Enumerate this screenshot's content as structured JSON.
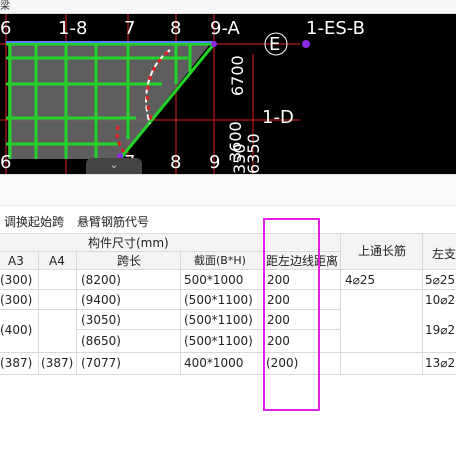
{
  "window": {
    "title_fragment": "梁"
  },
  "cad": {
    "top_labels": [
      "6",
      "1-8",
      "7",
      "8",
      "9-A",
      "E",
      "1-ES-B"
    ],
    "bottom_labels": [
      "6",
      "7",
      "8",
      "9"
    ],
    "side_labels": [
      "1-D"
    ],
    "dimension_labels": [
      "6700",
      "3600",
      "6350",
      "350"
    ],
    "grip_label": "⌄",
    "colors": {
      "background": "#000000",
      "beam_green": "#22d42a",
      "axis_red": "#e02020",
      "purple_marker": "#8a2be2"
    }
  },
  "toolbar": {
    "swap_start_span_label": "调换起始跨",
    "cantilever_rebar_code_label": "悬臂钢筋代号"
  },
  "table": {
    "group_header": "构件尺寸(mm)",
    "columns": {
      "a3": "A3",
      "a4": "A4",
      "span": "跨长",
      "section": "截面(B*H)",
      "offset": "距左边线距离",
      "top_rebar": "上通长筋",
      "left_support": "左支"
    },
    "rows": [
      {
        "a3": "(300)",
        "a4": "",
        "span": "(8200)",
        "section": "500*1000",
        "offset": "200",
        "top_rebar": "4⌀25",
        "left_support": "5⌀25"
      },
      {
        "a3": "(300)",
        "a4": "",
        "span": "(9400)",
        "section": "(500*1100)",
        "offset": "200",
        "top_rebar": "",
        "left_support": "10⌀2"
      },
      {
        "a3": "(400)",
        "a4": "",
        "span": "(3050)",
        "section": "(500*1100)",
        "offset": "200",
        "top_rebar": "",
        "left_support": "19⌀2"
      },
      {
        "a3": "",
        "a4": "",
        "span": "(8650)",
        "section": "(500*1100)",
        "offset": "200",
        "top_rebar": "",
        "left_support": ""
      },
      {
        "a3": "(387)",
        "a4": "(387)",
        "span": "(7077)",
        "section": "400*1000",
        "offset": "(200)",
        "top_rebar": "",
        "left_support": "13⌀2"
      }
    ]
  },
  "annotation": {
    "highlight_color": "#e21ee6"
  }
}
